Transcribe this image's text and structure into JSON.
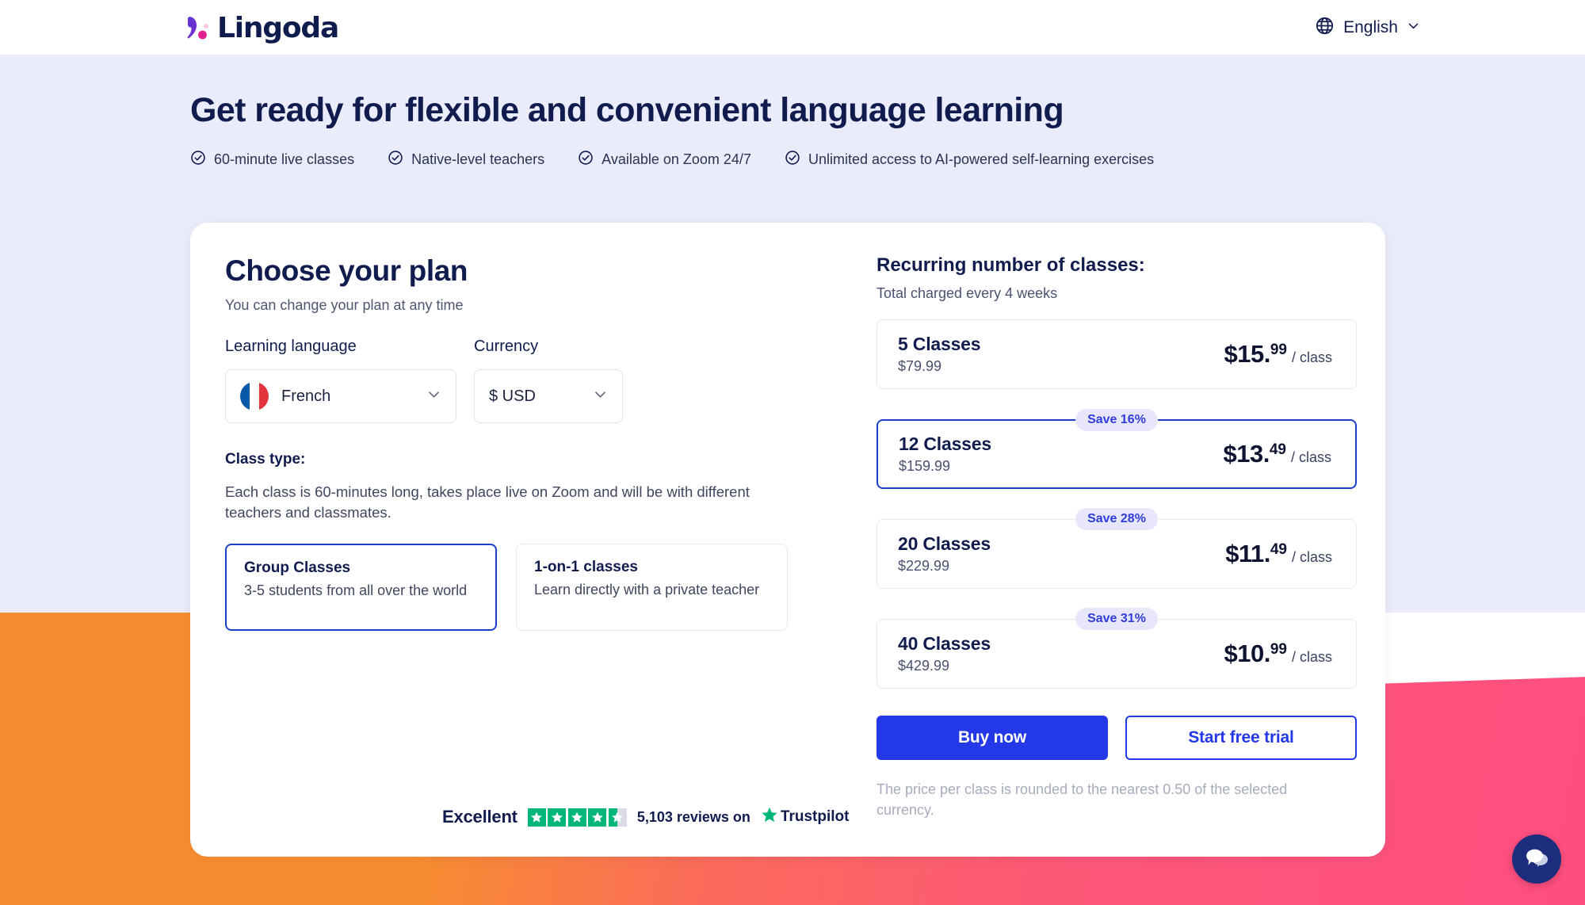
{
  "header": {
    "logo_text": "Lingoda",
    "logo_icon": "lingoda-comma-mark",
    "language_label": "English",
    "globe_icon": "globe-icon",
    "chevron_icon": "chevron-down-icon"
  },
  "hero": {
    "title": "Get ready for flexible and convenient language learning",
    "features": [
      {
        "icon": "check-circle-icon",
        "text": "60-minute live classes"
      },
      {
        "icon": "check-circle-icon",
        "text": "Native-level teachers"
      },
      {
        "icon": "check-circle-icon",
        "text": "Available on Zoom 24/7"
      },
      {
        "icon": "check-circle-icon",
        "text": "Unlimited access to AI-powered self-learning exercises"
      }
    ]
  },
  "plan_panel": {
    "title": "Choose your plan",
    "subtitle": "You can change your plan at any time",
    "language_field": {
      "label": "Learning language",
      "value": "French",
      "flag_icon": "france-flag-icon",
      "chevron_icon": "chevron-down-icon"
    },
    "currency_field": {
      "label": "Currency",
      "value": "$ USD",
      "chevron_icon": "chevron-down-icon"
    },
    "class_type": {
      "label": "Class type:",
      "description": "Each class is 60-minutes long, takes place live on Zoom and will be with different teachers and classmates.",
      "options": [
        {
          "title": "Group Classes",
          "desc": "3-5 students from all over the world",
          "selected": true
        },
        {
          "title": "1-on-1 classes",
          "desc": "Learn directly with a private teacher",
          "selected": false
        }
      ]
    },
    "trustpilot": {
      "rating_word": "Excellent",
      "stars_filled": 4,
      "stars_half": 1,
      "stars_total": 5,
      "reviews_text": "5,103 reviews on",
      "brand": "Trustpilot",
      "star_icon": "star-icon",
      "star_color": "#00b67a"
    }
  },
  "pricing": {
    "title": "Recurring number of classes:",
    "subtitle": "Total charged every 4 weeks",
    "plans": [
      {
        "name": "5 Classes",
        "total": "$79.99",
        "price_main": "$15.",
        "price_cents": "99",
        "price_per": "/ class",
        "save_badge": "",
        "selected": false
      },
      {
        "name": "12 Classes",
        "total": "$159.99",
        "price_main": "$13.",
        "price_cents": "49",
        "price_per": "/ class",
        "save_badge": "Save 16%",
        "selected": true
      },
      {
        "name": "20 Classes",
        "total": "$229.99",
        "price_main": "$11.",
        "price_cents": "49",
        "price_per": "/ class",
        "save_badge": "Save 28%",
        "selected": false
      },
      {
        "name": "40 Classes",
        "total": "$429.99",
        "price_main": "$10.",
        "price_cents": "99",
        "price_per": "/ class",
        "save_badge": "Save 31%",
        "selected": false
      }
    ],
    "buy_button": "Buy now",
    "trial_button": "Start free trial",
    "fineprint": "The price per class is rounded to the nearest 0.50 of the selected currency."
  },
  "chat": {
    "icon": "chat-bubble-icon"
  },
  "colors": {
    "brand_navy": "#101c4e",
    "accent_blue": "#2339e8",
    "badge_bg": "#e8e6fb",
    "badge_text": "#2f3ddb",
    "hero_bg": "#eaecfb",
    "orange": "#f78d30",
    "pink": "#fe4e7f",
    "trustpilot_green": "#00b67a"
  }
}
